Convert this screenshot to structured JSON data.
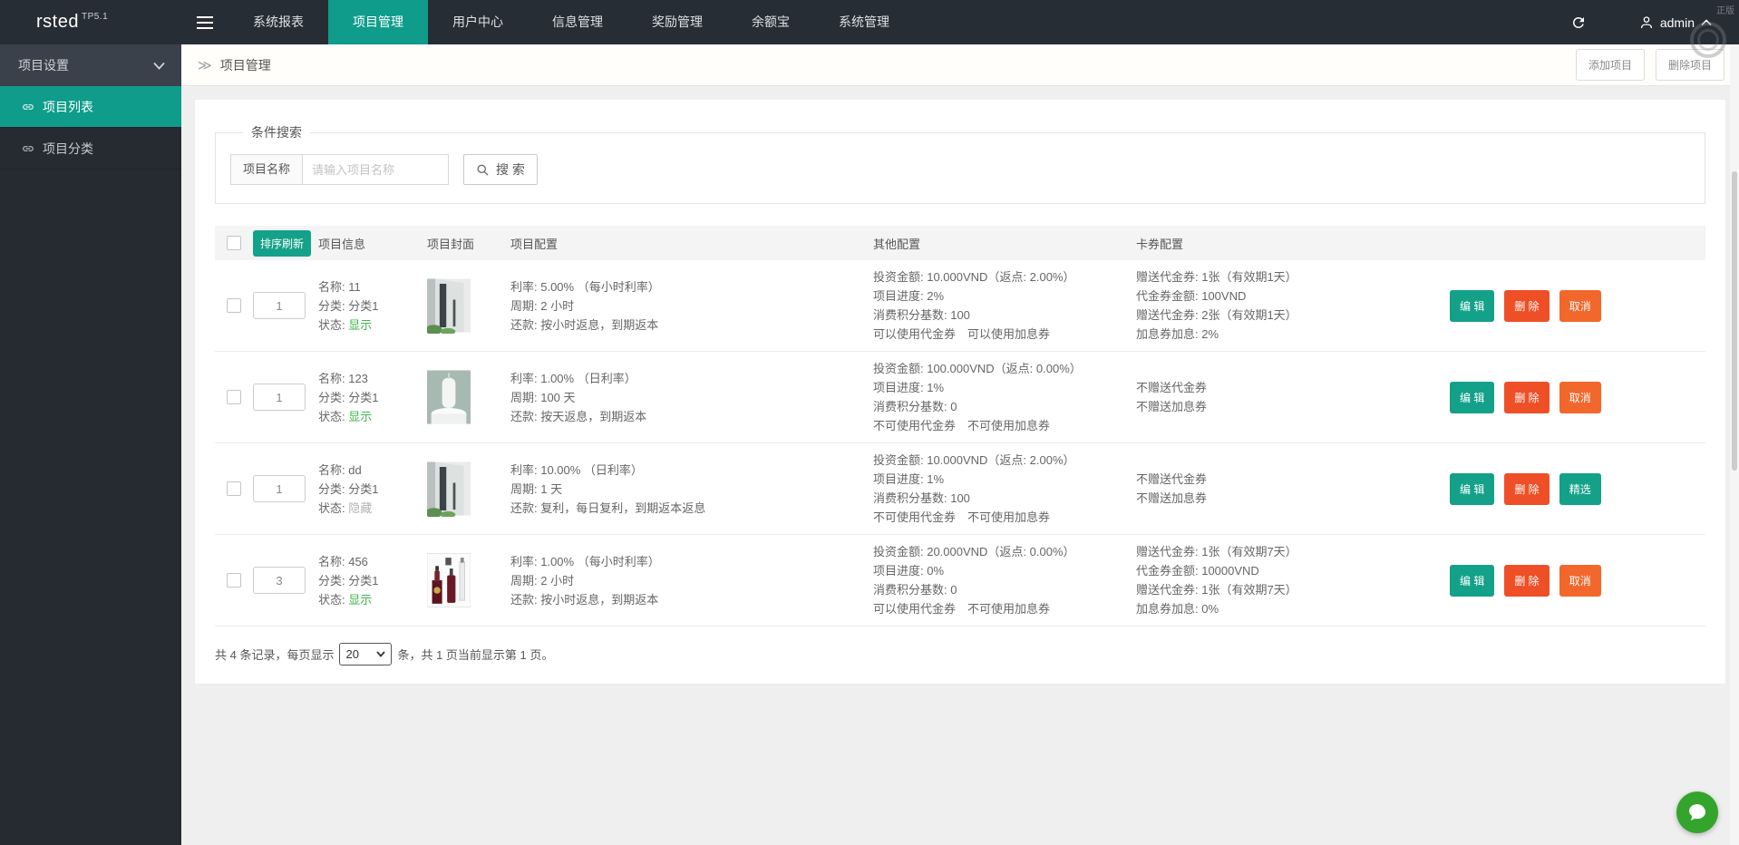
{
  "colors": {
    "accent_teal": "#0f9c8b",
    "accent_orange": "#ee4f26",
    "status_green": "#3cb54a",
    "fab_green": "#34a52c"
  },
  "topbar": {
    "logo": "rsted",
    "logo_version": "TP5.1",
    "nav": [
      {
        "label": "系统报表"
      },
      {
        "label": "项目管理",
        "active": true
      },
      {
        "label": "用户中心"
      },
      {
        "label": "信息管理"
      },
      {
        "label": "奖励管理"
      },
      {
        "label": "余额宝"
      },
      {
        "label": "系统管理"
      }
    ],
    "username": "admin",
    "watermark": "正版"
  },
  "sidebar": {
    "group_label": "项目设置",
    "items": [
      {
        "label": "项目列表",
        "active": true
      },
      {
        "label": "项目分类"
      }
    ]
  },
  "header": {
    "arrow": "≫",
    "title": "项目管理",
    "add_button": "添加项目",
    "delete_button": "删除项目"
  },
  "search": {
    "legend": "条件搜索",
    "field_label": "项目名称",
    "placeholder": "请输入项目名称",
    "button_label": "搜 索"
  },
  "table": {
    "headers": {
      "sort": "排序刷新",
      "info": "项目信息",
      "cover": "项目封面",
      "config": "项目配置",
      "other": "其他配置",
      "card": "卡券配置"
    },
    "rows": [
      {
        "sort": "1",
        "info": {
          "name": "名称: 11",
          "category": "分类: 分类1",
          "status_label": "状态:",
          "status": "显示"
        },
        "cover": "building-photo",
        "config": [
          "利率: 5.00% （每小时利率）",
          "周期: 2 小时",
          "还款: 按小时返息，到期返本"
        ],
        "other": [
          "投资金额: 10.000VND（返点: 2.00%）",
          "项目进度: 2%",
          "消费积分基数: 100",
          "可以使用代金券　可以使用加息券"
        ],
        "card": [
          "赠送代金券: 1张（有效期1天）",
          "代金券金额: 100VND",
          "赠送代金券: 2张（有效期1天）",
          "加息券加息: 2%"
        ],
        "actions": {
          "edit": "编 辑",
          "delete": "删 除",
          "toggle": "取消"
        }
      },
      {
        "sort": "1",
        "info": {
          "name": "名称: 123",
          "category": "分类: 分类1",
          "status_label": "状态:",
          "status": "显示"
        },
        "cover": "candle-photo",
        "config": [
          "利率: 1.00% （日利率）",
          "周期: 100 天",
          "还款: 按天返息，到期返本"
        ],
        "other": [
          "投资金额: 100.000VND（返点: 0.00%）",
          "项目进度: 1%",
          "消费积分基数: 0",
          "不可使用代金券　不可使用加息券"
        ],
        "card": [
          "不赠送代金券",
          "不赠送加息券"
        ],
        "actions": {
          "edit": "编 辑",
          "delete": "删 除",
          "toggle": "取消"
        }
      },
      {
        "sort": "1",
        "info": {
          "name": "名称: dd",
          "category": "分类: 分类1",
          "status_label": "状态:",
          "status": "隐藏"
        },
        "cover": "building-photo",
        "config": [
          "利率: 10.00% （日利率）",
          "周期: 1 天",
          "还款: 复利，每日复利，到期返本返息"
        ],
        "other": [
          "投资金额: 10.000VND（返点: 2.00%）",
          "项目进度: 1%",
          "消费积分基数: 100",
          "不可使用代金券　不可使用加息券"
        ],
        "card": [
          "不赠送代金券",
          "不赠送加息券"
        ],
        "actions": {
          "edit": "编 辑",
          "delete": "删 除",
          "toggle": "精选"
        }
      },
      {
        "sort": "3",
        "info": {
          "name": "名称: 456",
          "category": "分类: 分类1",
          "status_label": "状态:",
          "status": "显示"
        },
        "cover": "bottles-photo",
        "config": [
          "利率: 1.00% （每小时利率）",
          "周期: 2 小时",
          "还款: 按小时返息，到期返本"
        ],
        "other": [
          "投资金额: 20.000VND（返点: 0.00%）",
          "项目进度: 0%",
          "消费积分基数: 0",
          "可以使用代金券　不可使用加息券"
        ],
        "card": [
          "赠送代金券: 1张（有效期7天）",
          "代金券金额: 10000VND",
          "赠送代金券: 1张（有效期7天）",
          "加息券加息: 0%"
        ],
        "actions": {
          "edit": "编 辑",
          "delete": "删 除",
          "toggle": "取消"
        }
      }
    ]
  },
  "pagination": {
    "prefix": "共 4 条记录，每页显示",
    "page_size": "20",
    "suffix": "条，共 1 页当前显示第 1 页。"
  }
}
